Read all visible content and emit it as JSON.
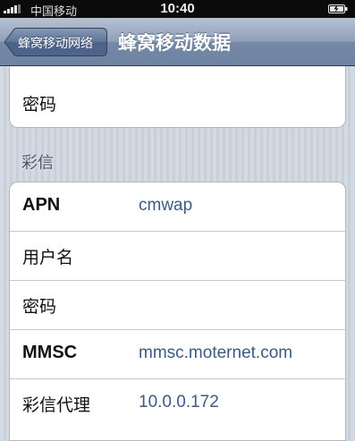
{
  "status_bar": {
    "carrier": "中国移动",
    "time": "10:40",
    "icons": [
      "signal-icon",
      "battery-icon"
    ]
  },
  "nav": {
    "back_label": "蜂窝移动网络",
    "title": "蜂窝移动数据"
  },
  "top_group": {
    "rows": [
      {
        "key": "密码",
        "value": ""
      }
    ]
  },
  "mms_section": {
    "header": "彩信",
    "rows": [
      {
        "key": "APN",
        "value": "cmwap"
      },
      {
        "key": "用户名",
        "value": ""
      },
      {
        "key": "密码",
        "value": ""
      },
      {
        "key": "MMSC",
        "value": "mmsc.moternet.com"
      },
      {
        "key": "彩信代理",
        "value": "10.0.0.172"
      }
    ]
  },
  "colors": {
    "nav_bar": "#7a8da9",
    "value_text": "#3b5b86",
    "background": "#cfd5de"
  }
}
